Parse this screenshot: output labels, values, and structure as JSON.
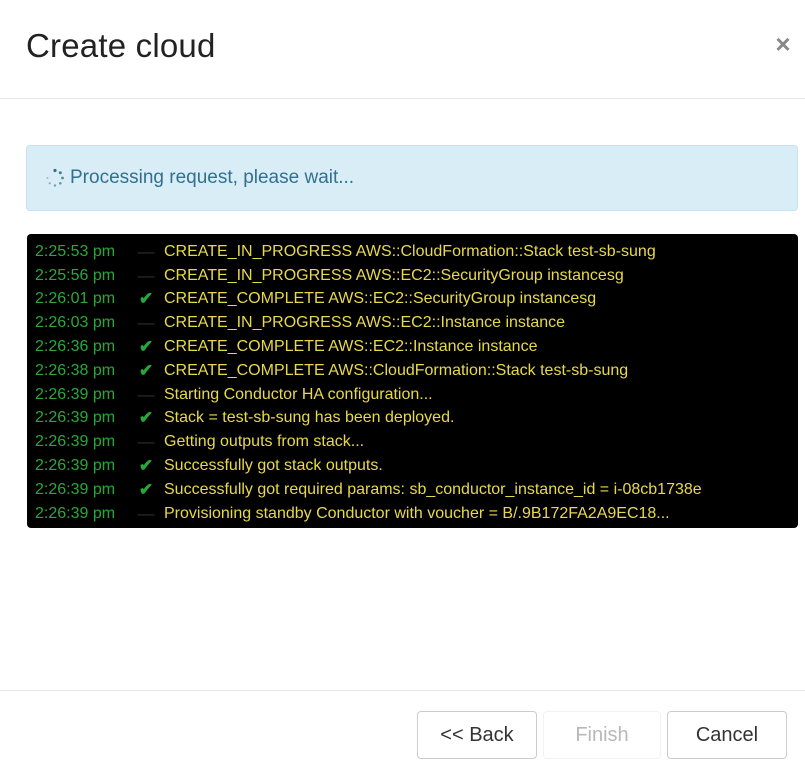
{
  "dialog": {
    "title": "Create cloud",
    "close_label": "×"
  },
  "alert": {
    "text": "Processing request, please wait..."
  },
  "log": {
    "lines": [
      {
        "time": "2:25:53 pm",
        "status": "dash",
        "message": "CREATE_IN_PROGRESS AWS::CloudFormation::Stack test-sb-sung"
      },
      {
        "time": "2:25:56 pm",
        "status": "dash",
        "message": "CREATE_IN_PROGRESS AWS::EC2::SecurityGroup instancesg"
      },
      {
        "time": "2:26:01 pm",
        "status": "check",
        "message": "CREATE_COMPLETE AWS::EC2::SecurityGroup instancesg"
      },
      {
        "time": "2:26:03 pm",
        "status": "dash",
        "message": "CREATE_IN_PROGRESS AWS::EC2::Instance instance"
      },
      {
        "time": "2:26:36 pm",
        "status": "check",
        "message": "CREATE_COMPLETE AWS::EC2::Instance instance"
      },
      {
        "time": "2:26:38 pm",
        "status": "check",
        "message": "CREATE_COMPLETE AWS::CloudFormation::Stack test-sb-sung"
      },
      {
        "time": "2:26:39 pm",
        "status": "dash",
        "message": "Starting Conductor HA configuration..."
      },
      {
        "time": "2:26:39 pm",
        "status": "check",
        "message": "Stack = test-sb-sung has been deployed."
      },
      {
        "time": "2:26:39 pm",
        "status": "dash",
        "message": "Getting outputs from stack..."
      },
      {
        "time": "2:26:39 pm",
        "status": "check",
        "message": "Successfully got stack outputs."
      },
      {
        "time": "2:26:39 pm",
        "status": "check",
        "message": "Successfully got required params: sb_conductor_instance_id = i-08cb1738e"
      },
      {
        "time": "2:26:39 pm",
        "status": "dash",
        "message": "Provisioning standby Conductor with voucher = B/.9B172FA2A9EC18..."
      }
    ]
  },
  "footer": {
    "back_label": "<< Back",
    "finish_label": "Finish",
    "cancel_label": "Cancel"
  },
  "icons": {
    "spinner": "spinner-icon",
    "check": "check-icon",
    "dash": "dash-icon"
  },
  "colors": {
    "alert_bg": "#d9edf7",
    "alert_text": "#31708f",
    "log_bg": "#000000",
    "timestamp": "#29a83a",
    "message": "#e8d94b"
  }
}
